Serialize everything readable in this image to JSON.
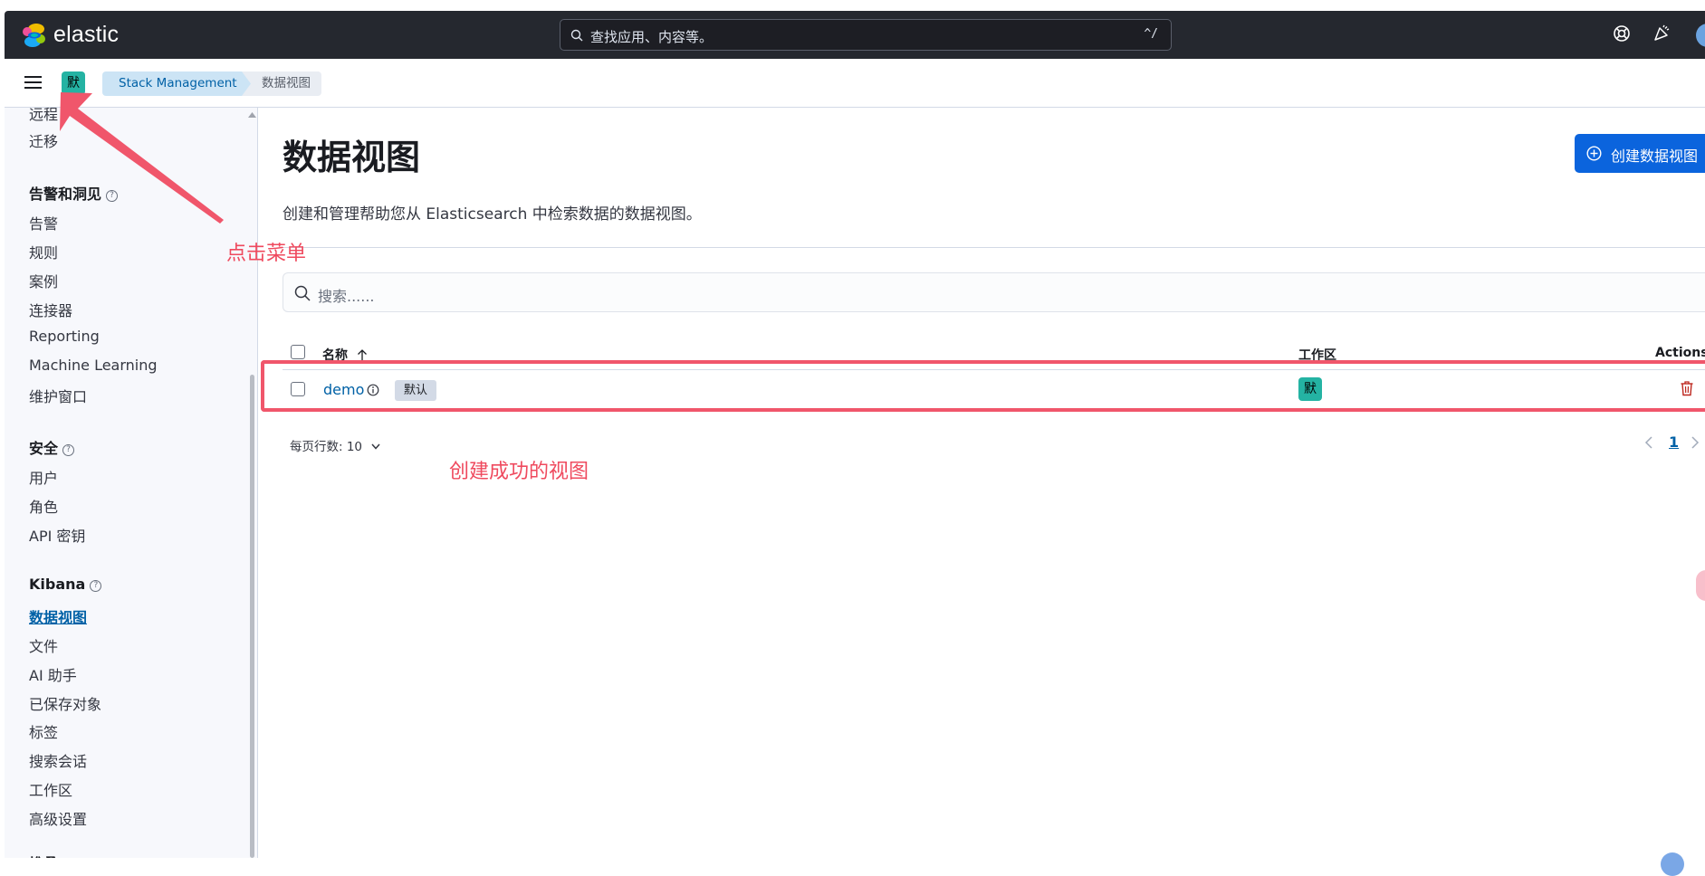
{
  "header": {
    "brand": "elastic",
    "search_placeholder": "查找应用、内容等。",
    "search_shortcut": "^/"
  },
  "subbar": {
    "space_initial": "默",
    "breadcrumbs": [
      "Stack Management",
      "数据视图"
    ]
  },
  "sidebar": {
    "items_top": [
      {
        "label": "远程"
      },
      {
        "label": "迁移"
      }
    ],
    "sections": [
      {
        "heading": "告警和洞见",
        "items": [
          "告警",
          "规则",
          "案例",
          "连接器",
          "Reporting",
          "Machine Learning",
          "维护窗口"
        ]
      },
      {
        "heading": "安全",
        "items": [
          "用户",
          "角色",
          "API 密钥"
        ]
      },
      {
        "heading": "Kibana",
        "items": [
          "数据视图",
          "文件",
          "AI 助手",
          "已保存对象",
          "标签",
          "搜索会话",
          "工作区",
          "高级设置"
        ]
      },
      {
        "heading": "堆叠"
      }
    ],
    "active_item": "数据视图"
  },
  "main": {
    "title": "数据视图",
    "description": "创建和管理帮助您从 Elasticsearch 中检索数据的数据视图。",
    "create_button": "创建数据视图",
    "search_placeholder": "搜索......",
    "columns": {
      "name": "名称",
      "space": "工作区",
      "actions": "Actions"
    },
    "rows": [
      {
        "name": "demo",
        "badge": "默认",
        "space_initial": "默"
      }
    ],
    "rows_per_page": "每页行数: 10",
    "current_page": "1"
  },
  "annotations": {
    "menu_hint": "点击菜单",
    "row_hint": "创建成功的视图",
    "color": "#ef4a5e"
  }
}
